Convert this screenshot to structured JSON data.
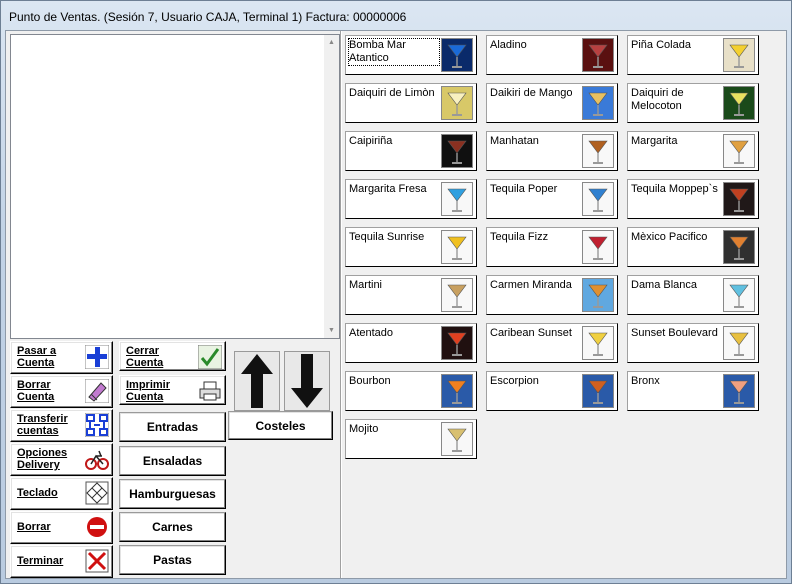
{
  "window": {
    "title": "Punto de Ventas. (Sesión  7, Usuario CAJA, Terminal 1) Factura: 00000006"
  },
  "actions": [
    {
      "id": "pasar-cuenta",
      "label": "Pasar a\nCuenta",
      "icon": "plus-icon"
    },
    {
      "id": "cerrar-cuenta",
      "label": "Cerrar\nCuenta",
      "icon": "checkmark-icon"
    },
    {
      "id": "borrar-cuenta",
      "label": "Borrar\nCuenta",
      "icon": "eraser-icon"
    },
    {
      "id": "imprimir-cuenta",
      "label": "Imprimir\nCuenta",
      "icon": "printer-icon"
    },
    {
      "id": "transferir-cuentas",
      "label": "Transferir\ncuentas",
      "icon": "network-icon"
    },
    {
      "id": "opciones-delivery",
      "label": "Opciones\nDelivery",
      "icon": "bicycle-icon"
    },
    {
      "id": "teclado",
      "label": "Teclado",
      "icon": "keypad-icon"
    },
    {
      "id": "borrar",
      "label": "Borrar",
      "icon": "no-entry-icon"
    },
    {
      "id": "terminar",
      "label": "Terminar",
      "icon": "close-icon"
    }
  ],
  "categories": [
    "Entradas",
    "Costeles",
    "Ensaladas",
    "Hamburguesas",
    "Carnes",
    "Pastas"
  ],
  "nav": {
    "up_icon": "arrow-up-icon",
    "down_icon": "arrow-down-icon"
  },
  "products": [
    "Bomba Mar Atantico",
    "Aladino",
    "Piña Colada",
    "Daiquiri de Limòn",
    "Daikiri de Mango",
    "Daiquiri de Melocoton",
    "Caipiriña",
    "Manhatan",
    "Margarita",
    "Margarita Fresa",
    "Tequila Poper",
    "Tequila Moppep`s",
    "Tequila Sunrise",
    "Tequila Fizz",
    "Mèxico Pacifico",
    "Martini",
    "Carmen Miranda",
    "Dama Blanca",
    "Atentado",
    "Caribean Sunset",
    "Sunset Boulevard",
    "Bourbon",
    "Escorpion",
    "Bronx",
    "Mojito"
  ],
  "colors": {
    "plus": "#1a3fd6",
    "check": "#2a8a2a",
    "stop": "#d01010"
  }
}
